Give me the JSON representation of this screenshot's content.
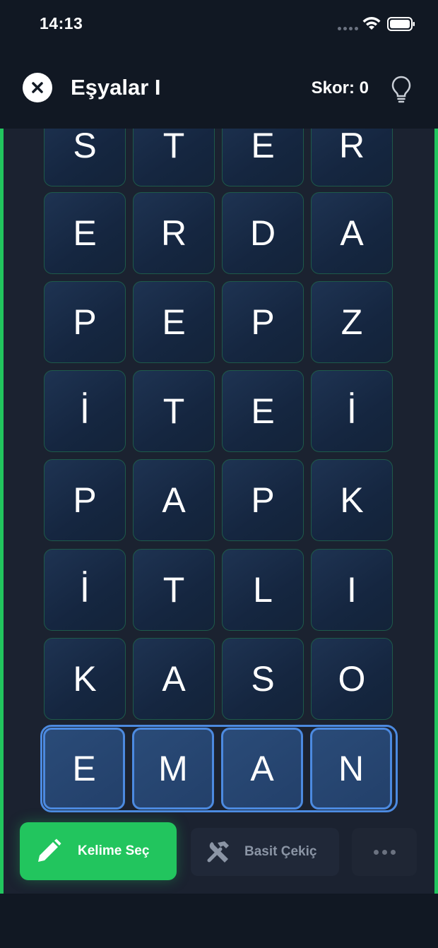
{
  "status_bar": {
    "time": "14:13"
  },
  "header": {
    "title": "Eşyalar I",
    "score_text": "Skor: 0"
  },
  "grid": {
    "rows": [
      [
        "S",
        "T",
        "E",
        "R"
      ],
      [
        "E",
        "R",
        "D",
        "A"
      ],
      [
        "P",
        "E",
        "P",
        "Z"
      ],
      [
        "İ",
        "T",
        "E",
        "İ"
      ],
      [
        "P",
        "A",
        "P",
        "K"
      ],
      [
        "İ",
        "T",
        "L",
        "I"
      ],
      [
        "K",
        "A",
        "S",
        "O"
      ],
      [
        "E",
        "M",
        "A",
        "N"
      ]
    ],
    "selected_row": 7
  },
  "toolbar": {
    "select_word_label": "Kelime Seç",
    "hammer_label": "Basit Çekiç"
  },
  "colors": {
    "accent_green": "#22c55e",
    "selection_blue": "#4c8ae0",
    "tile_border": "#1e5a4a"
  },
  "icons": {
    "close": "close-icon",
    "hint": "lightbulb-icon",
    "select_word": "pencil-icon",
    "hammer": "tools-icon",
    "more": "more-icon"
  }
}
